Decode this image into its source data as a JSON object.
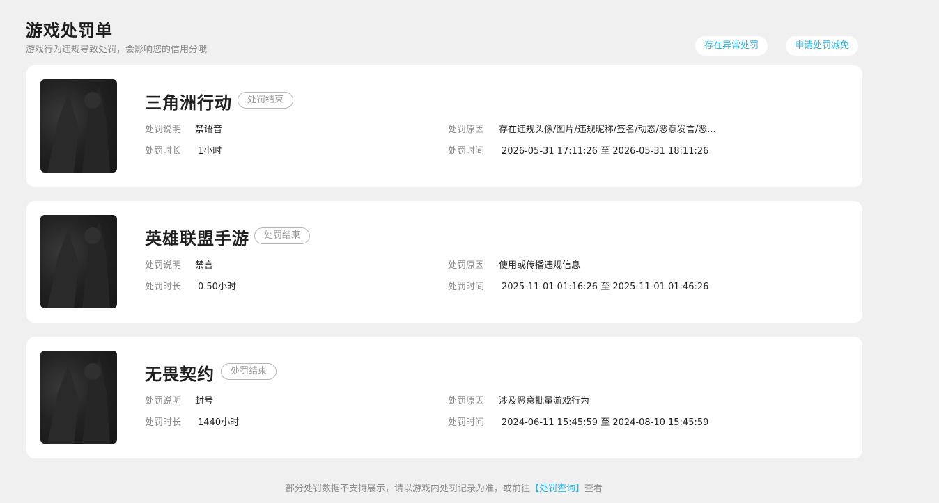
{
  "header": {
    "title": "游戏处罚单",
    "subtitle": "游戏行为违规导致处罚，会影响您的信用分哦",
    "actions": [
      "存在异常处罚",
      "申请处罚减免"
    ]
  },
  "labels": {
    "description": "处罚说明",
    "duration": "处罚时长",
    "reason": "处罚原因",
    "time": "处罚时间"
  },
  "cards": [
    {
      "game": "三角洲行动",
      "status": "处罚结束",
      "description": "禁语音",
      "duration": "1小时",
      "reason": "存在违规头像/图片/违规昵称/签名/动态/恶意发言/恶...",
      "time": "2026-05-31 17:11:26 至 2026-05-31 18:11:26"
    },
    {
      "game": "英雄联盟手游",
      "status": "处罚结束",
      "description": "禁言",
      "duration": "0.50小时",
      "reason": "使用或传播违规信息",
      "time": "2025-11-01 01:16:26 至 2025-11-01 01:46:26"
    },
    {
      "game": "无畏契约",
      "status": "处罚结束",
      "description": "封号",
      "duration": "1440小时",
      "reason": "涉及恶意批量游戏行为",
      "time": "2024-06-11 15:45:59 至 2024-08-10 15:45:59"
    }
  ],
  "footer": {
    "prefix": "部分处罚数据不支持展示，请以游戏内处罚记录为准，或前往",
    "link": "【处罚查询】",
    "suffix": "查看"
  }
}
